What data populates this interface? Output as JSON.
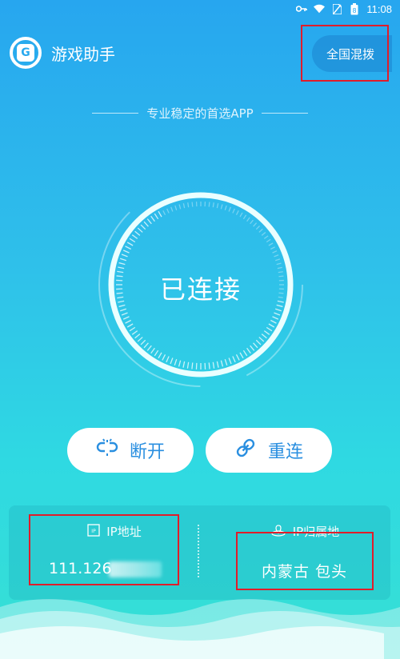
{
  "status_bar": {
    "time": "11:08",
    "battery_level": "8"
  },
  "header": {
    "app_title": "游戏助手",
    "logo_letter": "G",
    "mode_label": "全国混拨"
  },
  "tagline": "专业稳定的首选APP",
  "dial": {
    "status": "已连接"
  },
  "actions": {
    "disconnect_label": "断开",
    "reconnect_label": "重连"
  },
  "info": {
    "ip_label": "IP地址",
    "ip_value": "111.126",
    "location_label": "IP归属地",
    "location_value": "内蒙古 包头"
  },
  "colors": {
    "accent": "#2a8fe0",
    "highlight": "#e11c2a"
  }
}
